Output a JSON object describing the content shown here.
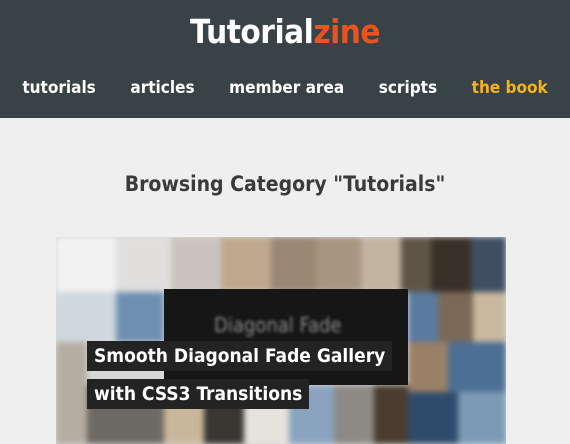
{
  "header": {
    "logo_part1": "Tutorial",
    "logo_part2": "zine",
    "nav": [
      "tutorials",
      "articles",
      "member area",
      "scripts",
      "the book"
    ],
    "accent_color": "#e8531e",
    "active_nav_color": "#f3b41b"
  },
  "main": {
    "heading": "Browsing Category \"Tutorials\"",
    "featured": {
      "image_text": "Diagonal Fade",
      "title_line1": "Smooth Diagonal Fade Gallery",
      "title_line2": "with CSS3 Transitions"
    }
  }
}
